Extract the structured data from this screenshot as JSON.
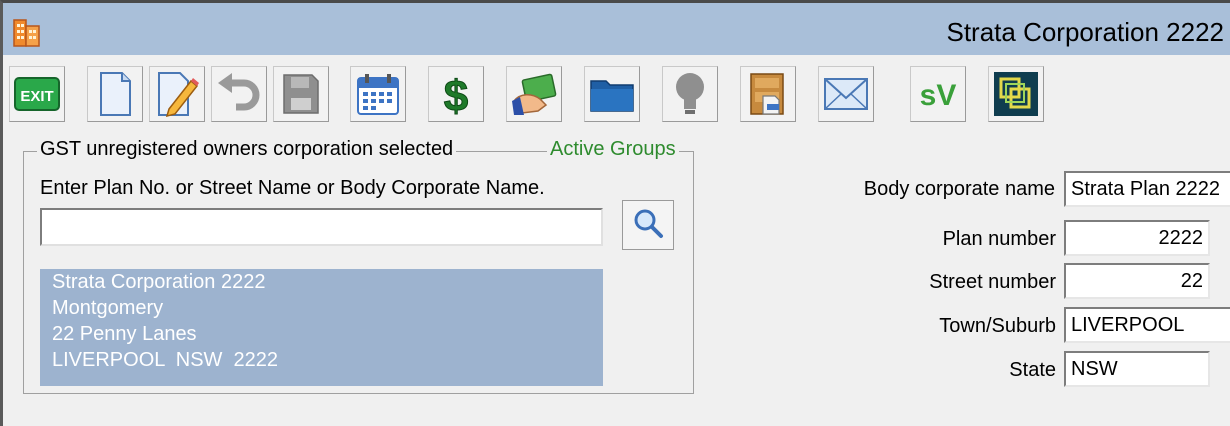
{
  "window": {
    "title": "Strata Corporation 2222"
  },
  "toolbar": {
    "buttons": [
      {
        "name": "exit-button",
        "icon": "exit-icon",
        "label": "EXIT"
      },
      {
        "name": "new-document-button",
        "icon": "blank-document-icon"
      },
      {
        "name": "edit-button",
        "icon": "edit-pencil-icon"
      },
      {
        "name": "undo-button",
        "icon": "undo-arrow-icon"
      },
      {
        "name": "save-button",
        "icon": "floppy-disk-icon"
      },
      {
        "name": "calendar-button",
        "icon": "calendar-icon"
      },
      {
        "name": "finance-button",
        "icon": "dollar-icon"
      },
      {
        "name": "payment-button",
        "icon": "hand-money-icon"
      },
      {
        "name": "folder-button",
        "icon": "folder-icon"
      },
      {
        "name": "ideas-button",
        "icon": "lightbulb-icon"
      },
      {
        "name": "archive-button",
        "icon": "archive-box-icon"
      },
      {
        "name": "email-button",
        "icon": "envelope-icon"
      },
      {
        "name": "sv-button",
        "icon": "sv-check-icon",
        "label": "sV"
      },
      {
        "name": "groups-button",
        "icon": "overlapping-squares-icon"
      }
    ]
  },
  "search_panel": {
    "status_text": "GST unregistered owners corporation selected",
    "groups_link": "Active Groups",
    "prompt": "Enter Plan No. or Street Name or Body Corporate Name.",
    "search_value": "",
    "result": {
      "line1": "Strata Corporation 2222",
      "line2": "Montgomery",
      "line3": "22 Penny Lanes",
      "line4": "LIVERPOOL  NSW  2222"
    }
  },
  "details": {
    "body_corporate_name_label": "Body corporate name",
    "body_corporate_name": "Strata Plan 2222",
    "plan_number_label": "Plan number",
    "plan_number": "2222",
    "street_number_label": "Street number",
    "street_number": "22",
    "town_label": "Town/Suburb",
    "town": "LIVERPOOL",
    "state_label": "State",
    "state": "NSW"
  },
  "colors": {
    "titlebar": "#a9bfd9",
    "selection": "#9db3cf",
    "accent_green": "#2e8b2e"
  }
}
